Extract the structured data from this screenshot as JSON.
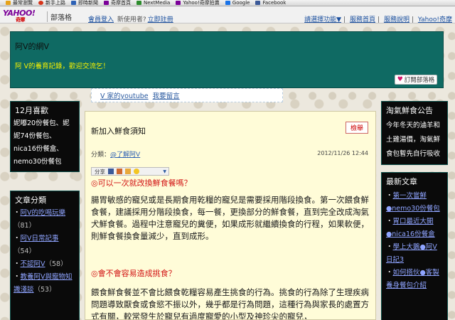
{
  "bookmarks": [
    {
      "label": "最常瀏覽",
      "icon": "folder-icon",
      "color": "#e6a21a"
    },
    {
      "label": "新手上路",
      "icon": "firefox-icon",
      "color": "#d6341a"
    },
    {
      "label": "即時新聞",
      "icon": "news-icon",
      "color": "#2d61b5"
    },
    {
      "label": "奇摩首頁",
      "icon": "yahoo-icon",
      "color": "#7b0099"
    },
    {
      "label": "NextMedia",
      "icon": "nextmedia-icon",
      "color": "#2d8c2d"
    },
    {
      "label": "Yahoo!奇摩拍賣",
      "icon": "yahoo-icon",
      "color": "#7b0099"
    },
    {
      "label": "Google",
      "icon": "google-icon",
      "color": "#1a73e8"
    },
    {
      "label": "Facebook",
      "icon": "facebook-icon",
      "color": "#3b5998"
    }
  ],
  "ybar": {
    "logo": "YAHOO!",
    "logo_sub": "奇摩",
    "blog": "部落格",
    "login": "會員登入",
    "new_user": "新使用者?",
    "register": "立即註冊",
    "right_links": [
      "請選擇功能▼",
      "服務首頁",
      "服務說明",
      "Yahoo!奇摩"
    ]
  },
  "header": {
    "title": "阿V的網V",
    "description": "阿 V的養育記錄，歡迎交流乞！",
    "subscribe": "訂閱部落格"
  },
  "ytbanner": {
    "link1": "V 家的youtube",
    "link2": "我要留言"
  },
  "left_col": {
    "visitor_head": "12月喜歡",
    "visitor_text": "妮嘟20份餐包、妮妮74份餐包、nica16份餐盒、nemo30份餐包",
    "cat_head": "文章分類",
    "categories": [
      {
        "name": "阿V的吃喝玩樂",
        "count": "（81）"
      },
      {
        "name": "阿V日常記事",
        "count": "（54）"
      },
      {
        "name": "不認阿V",
        "count": "（58）"
      },
      {
        "name": "教養阿V與寵物知識淺談",
        "count": "（53）"
      }
    ]
  },
  "post": {
    "title": "新加入鮮食須知",
    "report": "檢舉",
    "category_label": "分類：",
    "category": "@了解阿V",
    "date": "2012/11/26 12:44",
    "share": "分享",
    "q1": "◎可以一次就改換鮮食餐嗎？",
    "p1": "腸胃敏感的寵兒或是長期食用乾糧的寵兒是需要採用階段換食。第一次餵食鮮食餐，建議採用分階段換食，每一餐，更換部分的鮮食餐，直到完全改成淘氣犬鮮食餐。過程中注意寵兒的糞便，如果成形就繼續換食的行程，如果軟便，則鮮食餐換食量減少，直到成形。",
    "q2": "◎會不會容易造成挑食？",
    "p2": "餵食鮮食餐並不會比餵食乾糧容易產生挑食的行為。挑食的行為除了生理疾病問題導致厭食或食慾不振以外，幾乎都是行為問題，這種行為與家長的處置方式有關，較常發生於寵兒有過度寵愛的小型及神珍尖的寵兒，"
  },
  "right_col": {
    "ann_head": "淘氣鮮食公告",
    "ann_text": "今年冬天的滷羊和土雞湯價，淘氣鮮食包暫先自行吸收",
    "recent_head": "最新文章",
    "recent": [
      "第一次嘗鮮 ●nemo30份餐包",
      "胃口最近大開 ●nica16份餐盒",
      "學上大鵝●阿V日記3",
      "如何搭伙●客製養身餐包介紹"
    ]
  }
}
